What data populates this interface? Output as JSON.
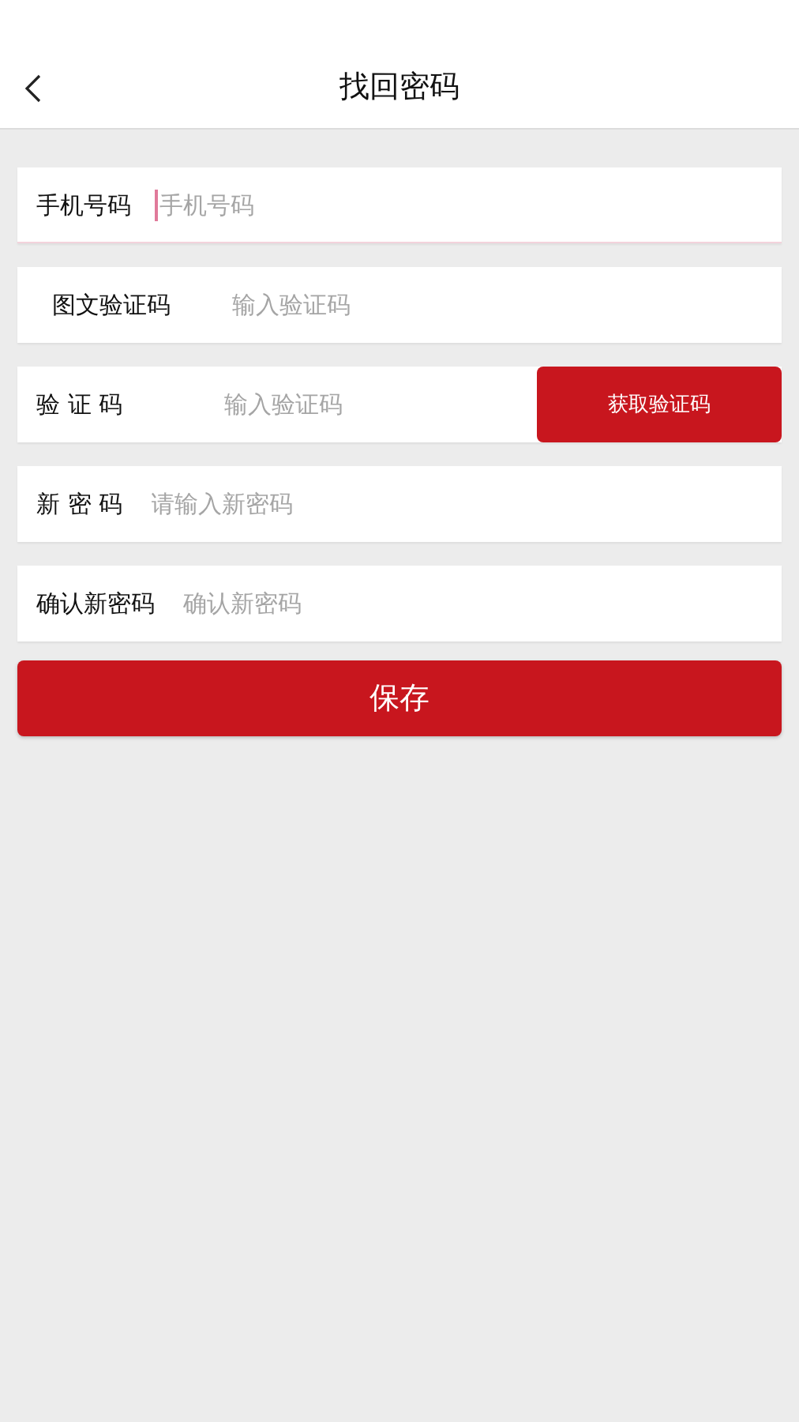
{
  "header": {
    "title": "找回密码"
  },
  "fields": [
    {
      "kind": "text",
      "label": "手机号码",
      "placeholder": "手机号码",
      "focused": true
    },
    {
      "kind": "captcha",
      "label": "图文验证码",
      "placeholder": "输入验证码",
      "focused": false
    },
    {
      "kind": "sms",
      "label": "验 证 码",
      "placeholder": "输入验证码",
      "focused": false,
      "button": "获取验证码"
    },
    {
      "kind": "text",
      "label": "新 密 码",
      "placeholder": "请输入新密码",
      "focused": false
    },
    {
      "kind": "text",
      "label": "确认新密码",
      "placeholder": "确认新密码",
      "focused": false
    }
  ],
  "save_button": "保存"
}
